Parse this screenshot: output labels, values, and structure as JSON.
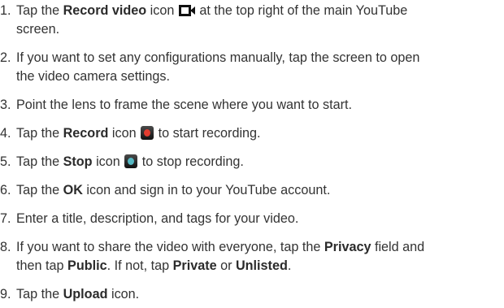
{
  "steps": [
    {
      "number": "1.",
      "before": "Tap the ",
      "bold": "Record video",
      "middle": " icon",
      "after": " at the top right of the main YouTube",
      "line2": "screen."
    },
    {
      "number": "2.",
      "line1": "If you want to set any configurations manually, tap the screen to open",
      "line2": "the video camera settings."
    },
    {
      "number": "3.",
      "line1": "Point the lens to frame the scene where you want to start."
    },
    {
      "number": "4.",
      "before": "Tap the ",
      "bold": "Record",
      "middle": " icon",
      "after": " to start recording."
    },
    {
      "number": "5.",
      "before": "Tap the ",
      "bold": "Stop",
      "middle": " icon",
      "after": " to stop recording."
    },
    {
      "number": "6.",
      "before": "Tap the ",
      "bold": "OK",
      "after": " icon and sign in to your YouTube account."
    },
    {
      "number": "7.",
      "line1": "Enter a title, description, and tags for your video."
    },
    {
      "number": "8.",
      "before": "If you want to share the video with everyone, tap the ",
      "bold1": "Privacy",
      "after1": " field and",
      "line2_before": "then tap ",
      "bold2": "Public",
      "line2_mid": ". If not, tap ",
      "bold3": "Private",
      "line2_or": " or ",
      "bold4": "Unlisted",
      "line2_end": "."
    },
    {
      "number": "9.",
      "before": "Tap the ",
      "bold": "Upload",
      "after": " icon."
    }
  ],
  "icons": {
    "record_video": "video-camera-icon",
    "record": "record-button-icon",
    "stop": "stop-button-icon"
  },
  "colors": {
    "text": "#333333",
    "record_dot": "#e23c2f",
    "stop_dot": "#55b8c3"
  }
}
